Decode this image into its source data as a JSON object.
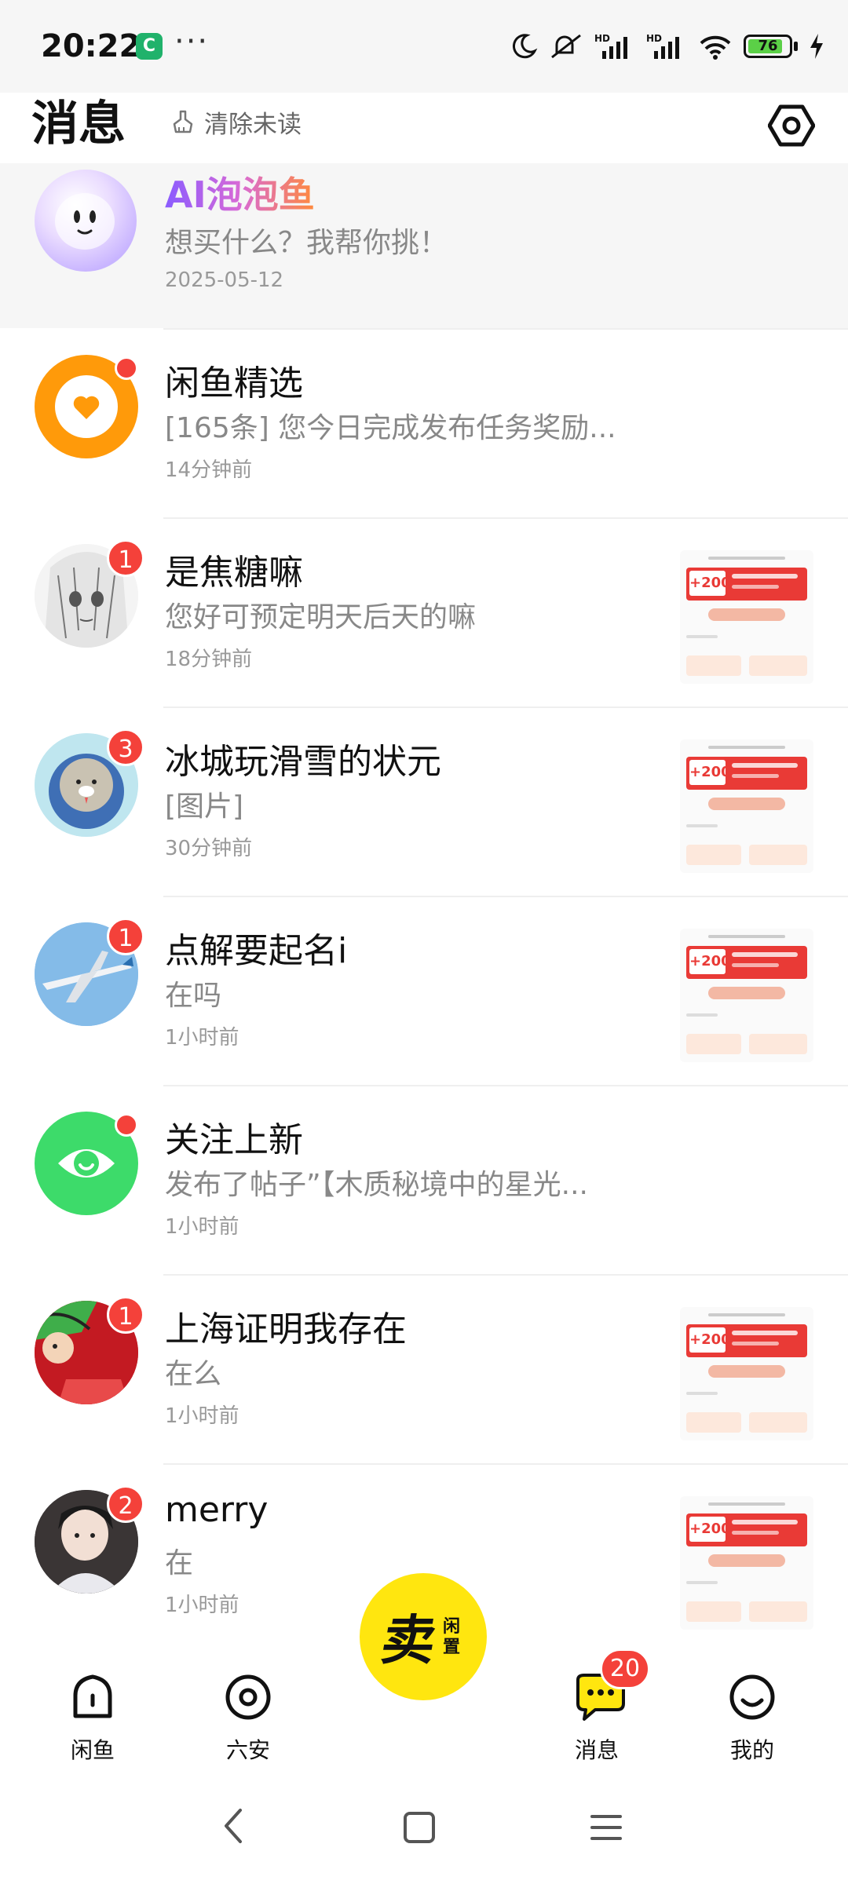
{
  "status_bar": {
    "time": "20:22",
    "app_icon": "C",
    "more": "···",
    "battery": "76",
    "icons": [
      "moon-icon",
      "mute-icon",
      "signal-hd-icon",
      "signal-hd-icon",
      "wifi-icon",
      "battery-icon",
      "charging-icon"
    ]
  },
  "header": {
    "title": "消息",
    "clear_unread": "清除未读",
    "settings_icon": "settings-icon"
  },
  "ai_chat": {
    "name": "AI泡泡鱼",
    "message": "想买什么？我帮你挑！",
    "date": "2025-05-12"
  },
  "conversations": [
    {
      "name": "闲鱼精选",
      "message": "[165条] 您今日完成发布任务奖励...",
      "time": "14分钟前",
      "badge": "",
      "dot": true,
      "thumb": false,
      "avatar": "orange-heart-icon"
    },
    {
      "name": "是焦糖嘛",
      "message": "您好可预定明天后天的嘛",
      "time": "18分钟前",
      "badge": "1",
      "dot": false,
      "thumb": true,
      "avatar": "anime-girl-avatar"
    },
    {
      "name": "冰城玩滑雪的状元",
      "message": "[图片]",
      "time": "30分钟前",
      "badge": "3",
      "dot": false,
      "thumb": true,
      "avatar": "cat-astronaut-avatar"
    },
    {
      "name": "点解要起名i",
      "message": "在吗",
      "time": "1小时前",
      "badge": "1",
      "dot": false,
      "thumb": true,
      "avatar": "airplane-avatar"
    },
    {
      "name": "关注上新",
      "message": "发布了帖子”【木质秘境中的星光...",
      "time": "1小时前",
      "badge": "",
      "dot": true,
      "thumb": false,
      "avatar": "green-eye-icon"
    },
    {
      "name": "上海证明我存在",
      "message": "在么",
      "time": "1小时前",
      "badge": "1",
      "dot": false,
      "thumb": true,
      "avatar": "cartoon-avatar"
    },
    {
      "name": "merry",
      "message": "在",
      "time": "1小时前",
      "badge": "2",
      "dot": false,
      "thumb": true,
      "avatar": "person-avatar"
    }
  ],
  "thumb_amount": "+200",
  "tabbar": {
    "tabs": [
      {
        "label": "闲鱼",
        "icon": "home-icon"
      },
      {
        "label": "六安",
        "icon": "location-icon"
      },
      {
        "label": "消息",
        "icon": "chat-bubble-icon",
        "badge": "20"
      },
      {
        "label": "我的",
        "icon": "profile-smile-icon"
      }
    ],
    "sell_big": "卖",
    "sell_small": "闲置"
  },
  "nav": [
    "back-icon",
    "home-square-icon",
    "menu-icon"
  ],
  "colors": {
    "accent_yellow": "#ffe60f",
    "badge_red": "#f4413a",
    "header_bg": "#f6f6f6"
  }
}
